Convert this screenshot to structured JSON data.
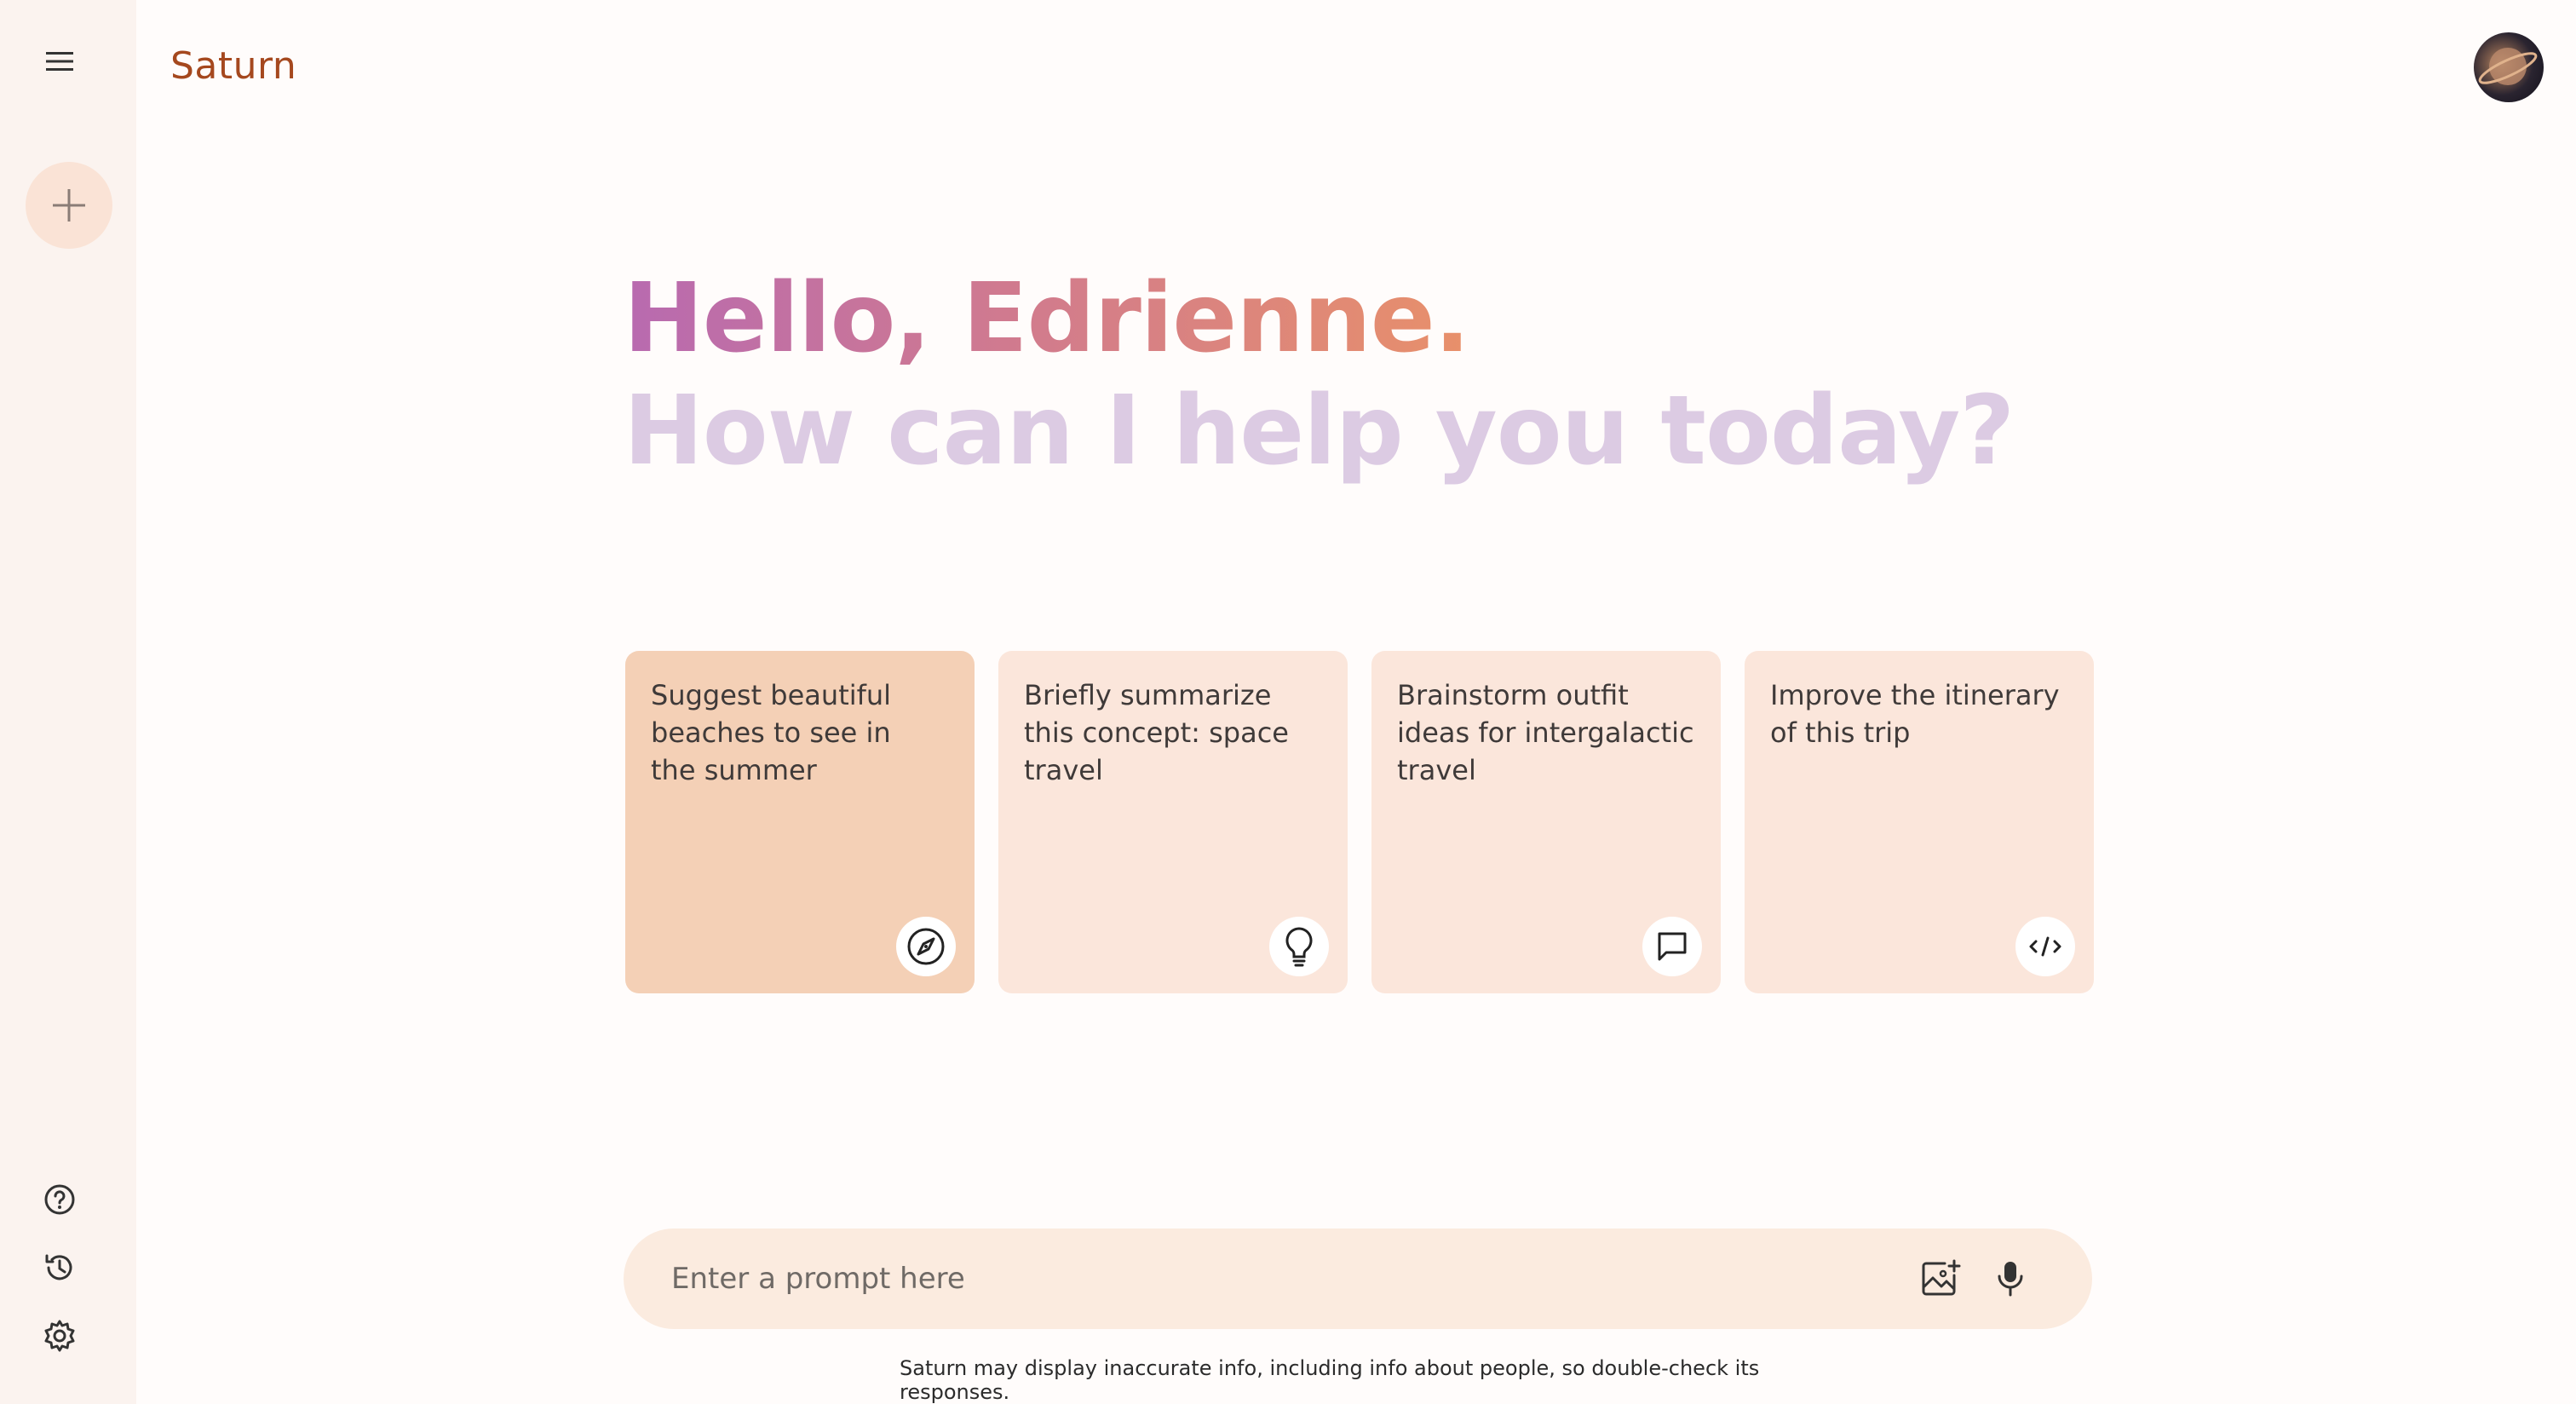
{
  "app": {
    "brand": "Saturn"
  },
  "sidebar": {
    "menu_icon": "hamburger-menu-icon",
    "new_chat_icon": "plus-icon",
    "bottom_icons": [
      "help-icon",
      "history-icon",
      "settings-icon"
    ]
  },
  "greeting": {
    "hello": "Hello, Edrienne.",
    "subtitle": "How can I help you today?"
  },
  "cards": [
    {
      "text": "Suggest beautiful beaches to see in the summer",
      "icon": "compass-icon",
      "active": true
    },
    {
      "text": "Briefly summarize this concept: space travel",
      "icon": "lightbulb-icon",
      "active": false
    },
    {
      "text": "Brainstorm outfit ideas for intergalactic travel",
      "icon": "chat-bubble-icon",
      "active": false
    },
    {
      "text": "Improve the itinerary of this trip",
      "icon": "code-icon",
      "active": false
    }
  ],
  "prompt": {
    "placeholder": "Enter a prompt here",
    "image_icon": "add-image-icon",
    "mic_icon": "microphone-icon"
  },
  "footer": {
    "disclaimer": "Saturn may display inaccurate info, including info about people, so double-check its responses."
  },
  "colors": {
    "brand": "#a5481e",
    "rail": "#fbf3ef",
    "card": "#fbe6db",
    "card_active": "#f4d0b6",
    "prompt_bg": "#fbebdf",
    "subtitle": "#dccbe3"
  }
}
